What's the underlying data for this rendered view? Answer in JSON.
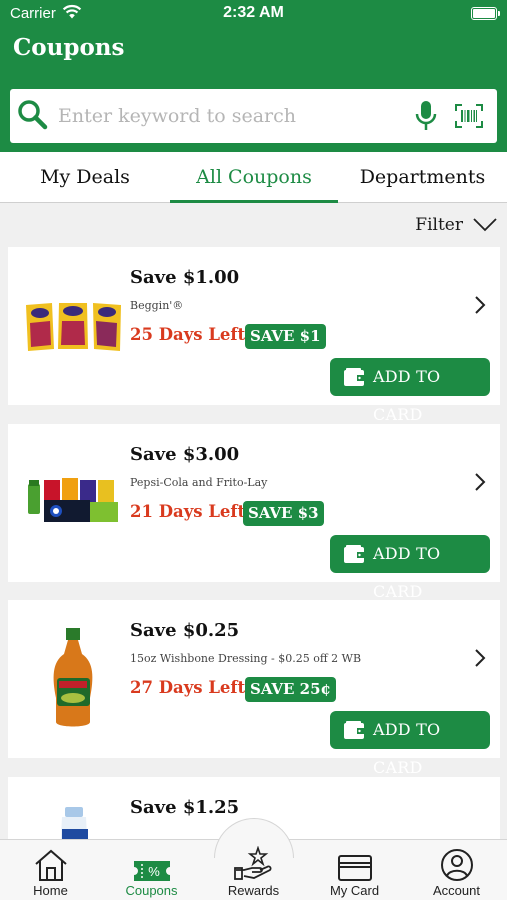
{
  "status": {
    "carrier": "Carrier",
    "time": "2:32 AM"
  },
  "header": {
    "title": "Coupons"
  },
  "search": {
    "placeholder": "Enter keyword to search"
  },
  "tabs": [
    {
      "label": "My Deals"
    },
    {
      "label": "All Coupons",
      "active": true
    },
    {
      "label": "Departments"
    }
  ],
  "filter": {
    "label": "Filter"
  },
  "coupons": [
    {
      "title": "Save $1.00",
      "desc": "Beggin'®",
      "days": "25 Days Left",
      "badge": "SAVE $1",
      "button": "ADD TO CARD",
      "image": "beggin-treats-bags"
    },
    {
      "title": "Save $3.00",
      "desc": "Pepsi-Cola and Frito-Lay",
      "days": "21 Days Left",
      "badge": "SAVE $3",
      "button": "ADD TO CARD",
      "image": "pepsi-fritolay-products"
    },
    {
      "title": "Save $0.25",
      "desc": "15oz Wishbone Dressing - $0.25 off 2 WB",
      "days": "27 Days Left",
      "badge": "SAVE 25¢",
      "button": "ADD TO CARD",
      "image": "wishbone-italian-bottle"
    },
    {
      "title": "Save $1.25",
      "image": "coffee-mate-bottle"
    }
  ],
  "bottom_nav": [
    {
      "label": "Home",
      "icon": "home-icon"
    },
    {
      "label": "Coupons",
      "icon": "coupon-ticket-icon",
      "active": true
    },
    {
      "label": "Rewards",
      "icon": "rewards-hand-star-icon"
    },
    {
      "label": "My Card",
      "icon": "card-icon"
    },
    {
      "label": "Account",
      "icon": "account-icon"
    }
  ],
  "colors": {
    "brand_green": "#1d8b44",
    "days_red": "#d93a1e"
  }
}
